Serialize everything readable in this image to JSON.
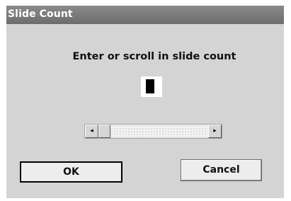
{
  "window": {
    "title": "Slide Count"
  },
  "prompt": "Enter or scroll in slide count",
  "count_field": {
    "value_icon": "black-block-cursor"
  },
  "scrollbar": {
    "left_arrow": "◂",
    "right_arrow": "▸",
    "position": 0
  },
  "buttons": {
    "ok_label": "OK",
    "cancel_label": "Cancel"
  }
}
